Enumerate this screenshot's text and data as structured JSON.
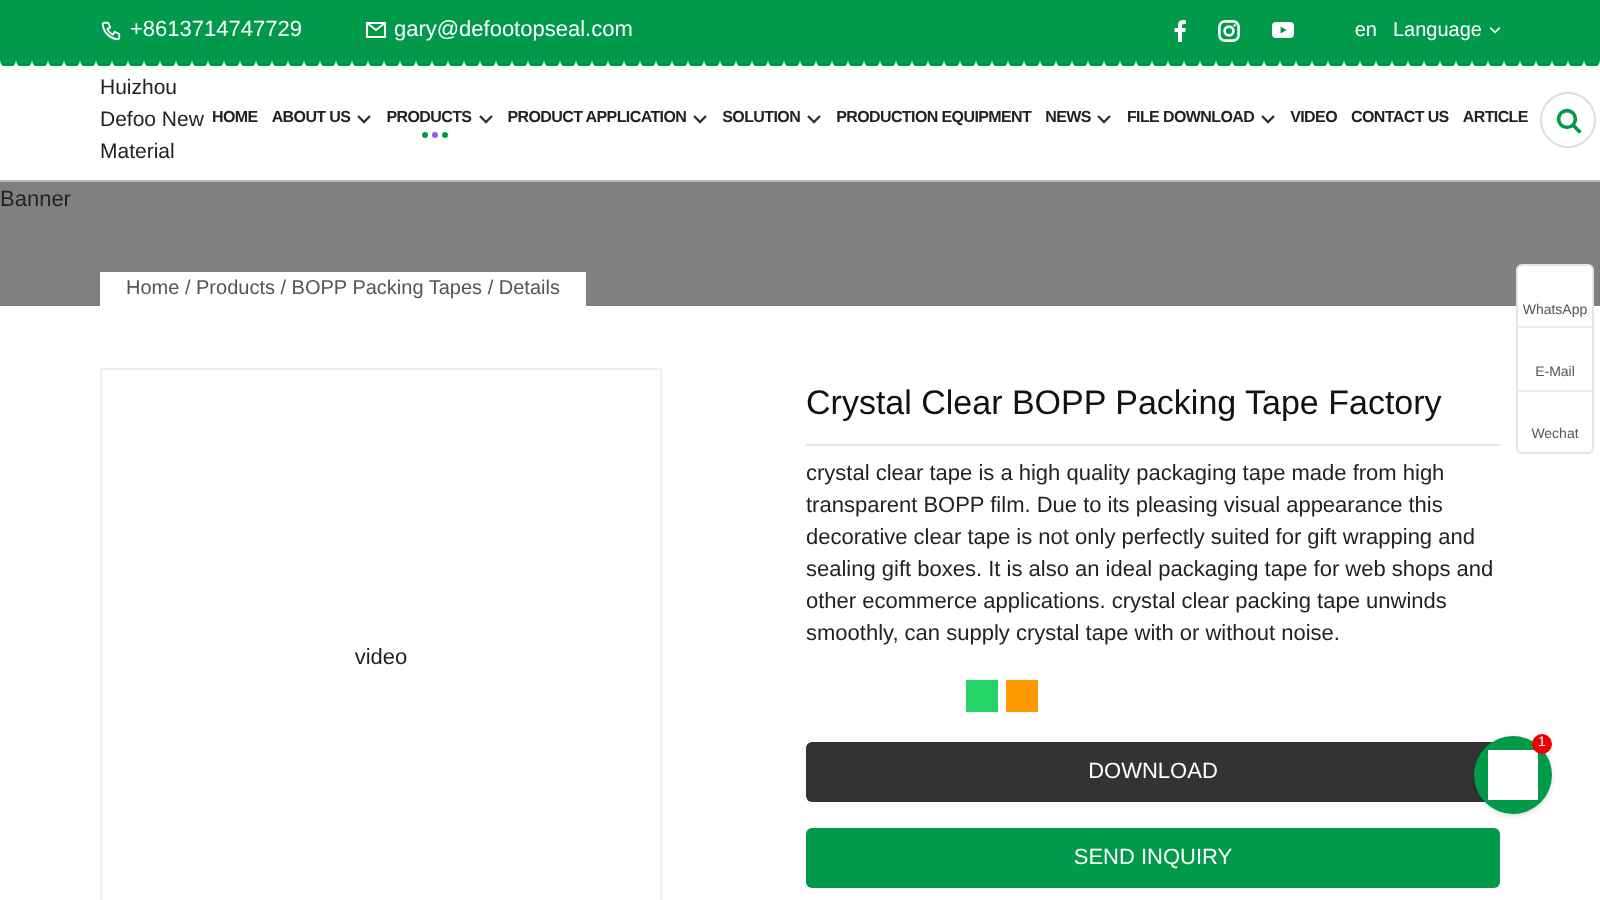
{
  "top_bar": {
    "phone": "+8613714747729",
    "email": "gary@defootopseal.com",
    "language_code": "en",
    "language": "Language"
  },
  "logo_text": "Huizhou Defoo New Material",
  "nav": [
    {
      "label": "HOME",
      "dropdown": false,
      "selected": false
    },
    {
      "label": "ABOUT US",
      "dropdown": true,
      "selected": false
    },
    {
      "label": "PRODUCTS",
      "dropdown": true,
      "selected": true
    },
    {
      "label": "PRODUCT APPLICATION",
      "dropdown": true,
      "selected": false
    },
    {
      "label": "SOLUTION",
      "dropdown": true,
      "selected": false
    },
    {
      "label": "PRODUCTION EQUIPMENT",
      "dropdown": false,
      "selected": false
    },
    {
      "label": "NEWS",
      "dropdown": true,
      "selected": false
    },
    {
      "label": "FILE DOWNLOAD",
      "dropdown": true,
      "selected": false
    },
    {
      "label": "VIDEO",
      "dropdown": false,
      "selected": false
    },
    {
      "label": "CONTACT US",
      "dropdown": false,
      "selected": false
    },
    {
      "label": "ARTICLE",
      "dropdown": false,
      "selected": false
    }
  ],
  "banner": {
    "label": "Banner",
    "breadcrumb": "Home / Products / BOPP Packing Tapes / Details"
  },
  "product": {
    "video_label": "video",
    "title": "Crystal Clear BOPP Packing Tape Factory",
    "description": "crystal clear tape is a high quality packaging tape made from high transparent BOPP film. Due to its pleasing visual appearance this decorative clear tape is not only perfectly suited for gift wrapping and sealing gift boxes. It is also an ideal packaging tape for web shops and other ecommerce applications. crystal clear packing tape unwinds smoothly, can supply crystal tape with or without noise.",
    "swatches": [
      {
        "color": "#25d366"
      },
      {
        "color": "#ff9900"
      }
    ],
    "download_button": "DOWNLOAD",
    "inquiry_button": "SEND INQUIRY"
  },
  "side_contacts": [
    "WhatsApp",
    "E-Mail",
    "Wechat"
  ],
  "chat_badge": "1"
}
